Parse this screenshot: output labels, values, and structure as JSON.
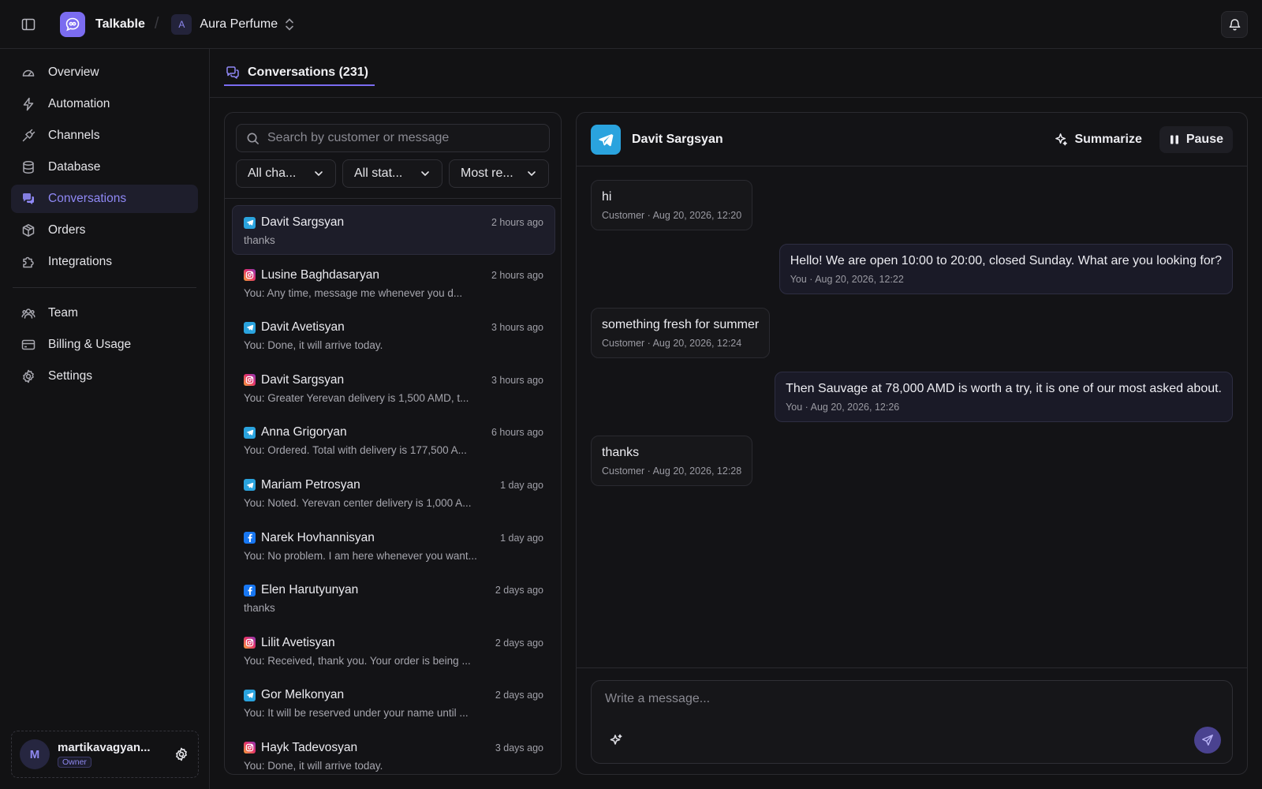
{
  "app": {
    "name": "Talkable"
  },
  "workspace": {
    "initial": "A",
    "name": "Aura Perfume"
  },
  "colors": {
    "accent": "#7b6cf0",
    "telegram": "#2aa3de",
    "facebook": "#1877f2",
    "background": "#121214"
  },
  "sidebar": {
    "items": [
      {
        "label": "Overview",
        "icon": "gauge-icon"
      },
      {
        "label": "Automation",
        "icon": "bolt-icon"
      },
      {
        "label": "Channels",
        "icon": "plug-icon"
      },
      {
        "label": "Database",
        "icon": "database-icon"
      },
      {
        "label": "Conversations",
        "icon": "chat-icon",
        "active": true
      },
      {
        "label": "Orders",
        "icon": "box-icon"
      },
      {
        "label": "Integrations",
        "icon": "puzzle-icon"
      }
    ],
    "secondary": [
      {
        "label": "Team",
        "icon": "users-icon"
      },
      {
        "label": "Billing & Usage",
        "icon": "card-icon"
      },
      {
        "label": "Settings",
        "icon": "gear-icon"
      }
    ],
    "user": {
      "initial": "M",
      "name": "martikavagyan...",
      "role": "Owner"
    }
  },
  "tab": {
    "label": "Conversations (231)"
  },
  "list": {
    "search_placeholder": "Search by customer or message",
    "filters": [
      "All cha...",
      "All stat...",
      "Most re..."
    ],
    "conversations": [
      {
        "channel": "telegram",
        "name": "Davit Sargsyan",
        "time": "2 hours ago",
        "preview": "thanks",
        "selected": true
      },
      {
        "channel": "instagram",
        "name": "Lusine Baghdasaryan",
        "time": "2 hours ago",
        "preview": "You: Any time, message me whenever you d..."
      },
      {
        "channel": "telegram",
        "name": "Davit Avetisyan",
        "time": "3 hours ago",
        "preview": "You: Done, it will arrive today."
      },
      {
        "channel": "instagram",
        "name": "Davit Sargsyan",
        "time": "3 hours ago",
        "preview": "You: Greater Yerevan delivery is 1,500 AMD, t..."
      },
      {
        "channel": "telegram",
        "name": "Anna Grigoryan",
        "time": "6 hours ago",
        "preview": "You: Ordered. Total with delivery is 177,500 A..."
      },
      {
        "channel": "telegram",
        "name": "Mariam Petrosyan",
        "time": "1 day ago",
        "preview": "You: Noted. Yerevan center delivery is 1,000 A..."
      },
      {
        "channel": "facebook",
        "name": "Narek Hovhannisyan",
        "time": "1 day ago",
        "preview": "You: No problem. I am here whenever you want..."
      },
      {
        "channel": "facebook",
        "name": "Elen Harutyunyan",
        "time": "2 days ago",
        "preview": "thanks"
      },
      {
        "channel": "instagram",
        "name": "Lilit Avetisyan",
        "time": "2 days ago",
        "preview": "You: Received, thank you. Your order is being ..."
      },
      {
        "channel": "telegram",
        "name": "Gor Melkonyan",
        "time": "2 days ago",
        "preview": "You: It will be reserved under your name until ..."
      },
      {
        "channel": "instagram",
        "name": "Hayk Tadevosyan",
        "time": "3 days ago",
        "preview": "You: Done, it will arrive today."
      }
    ]
  },
  "chat": {
    "contact_name": "Davit Sargsyan",
    "contact_channel": "telegram",
    "summarize_label": "Summarize",
    "pause_label": "Pause",
    "messages": [
      {
        "from": "customer",
        "text": "hi",
        "meta": "Customer · Aug 20, 2026, 12:20"
      },
      {
        "from": "you",
        "text": "Hello! We are open 10:00 to 20:00, closed Sunday. What are you looking for?",
        "meta": "You · Aug 20, 2026, 12:22"
      },
      {
        "from": "customer",
        "text": "something fresh for summer",
        "meta": "Customer · Aug 20, 2026, 12:24"
      },
      {
        "from": "you",
        "text": "Then Sauvage at 78,000 AMD is worth a try, it is one of our most asked about.",
        "meta": "You · Aug 20, 2026, 12:26"
      },
      {
        "from": "customer",
        "text": "thanks",
        "meta": "Customer · Aug 20, 2026, 12:28"
      }
    ],
    "composer_placeholder": "Write a message..."
  }
}
